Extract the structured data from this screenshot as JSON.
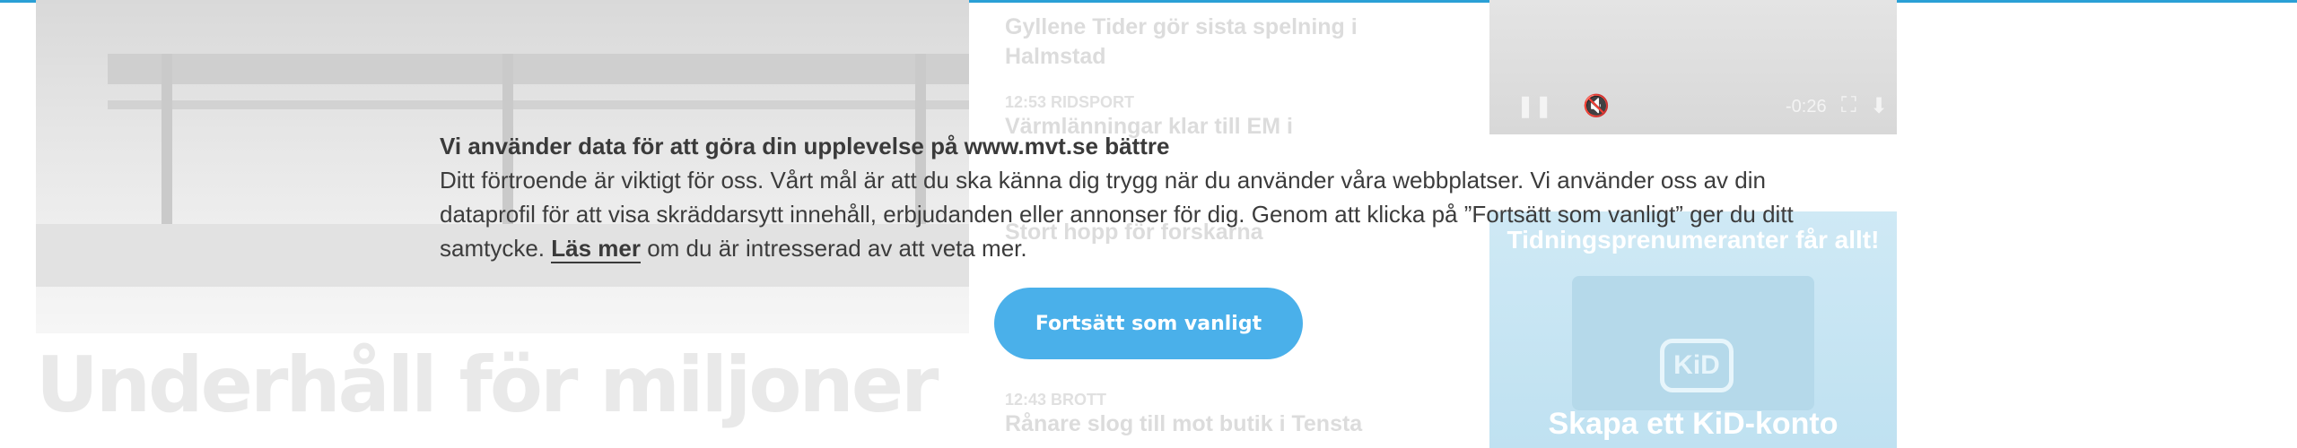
{
  "background": {
    "headline_line1": "Underhåll för miljoner",
    "headline_line2": "",
    "news": [
      {
        "meta": "",
        "title": "Gyllene Tider gör sista spelning i Halmstad"
      },
      {
        "meta": "12:53 RIDSPORT",
        "title": "Värmlänningar klar till EM i"
      },
      {
        "meta": "",
        "title": "Stort hopp för forskarna"
      },
      {
        "meta": "12:43 BROTT",
        "title": "Rånare slog till mot butik i Tensta"
      }
    ],
    "video": {
      "time": "-0:26"
    },
    "ad": {
      "headline": "Tidningsprenumeranter får allt!",
      "logo": "KiD",
      "cta": "Skapa ett KiD-konto"
    }
  },
  "consent": {
    "title": "Vi använder data för att göra din upplevelse på www.mvt.se bättre",
    "body_before_link": "Ditt förtroende är viktigt för oss. Vårt mål är att du ska känna dig trygg när du använder våra webbplatser. Vi använder oss av din dataprofil för att visa skräddarsytt innehåll, erbjudanden eller annonser för dig. Genom att klicka på ”Fortsätt som vanligt” ger du ditt samtycke. ",
    "link_label": "Läs mer",
    "body_after_link": " om du är intresserad av att veta mer.",
    "button_label": "Fortsätt som vanligt"
  },
  "colors": {
    "accent": "#4ab0ea",
    "top_line": "#2aa0d6"
  }
}
